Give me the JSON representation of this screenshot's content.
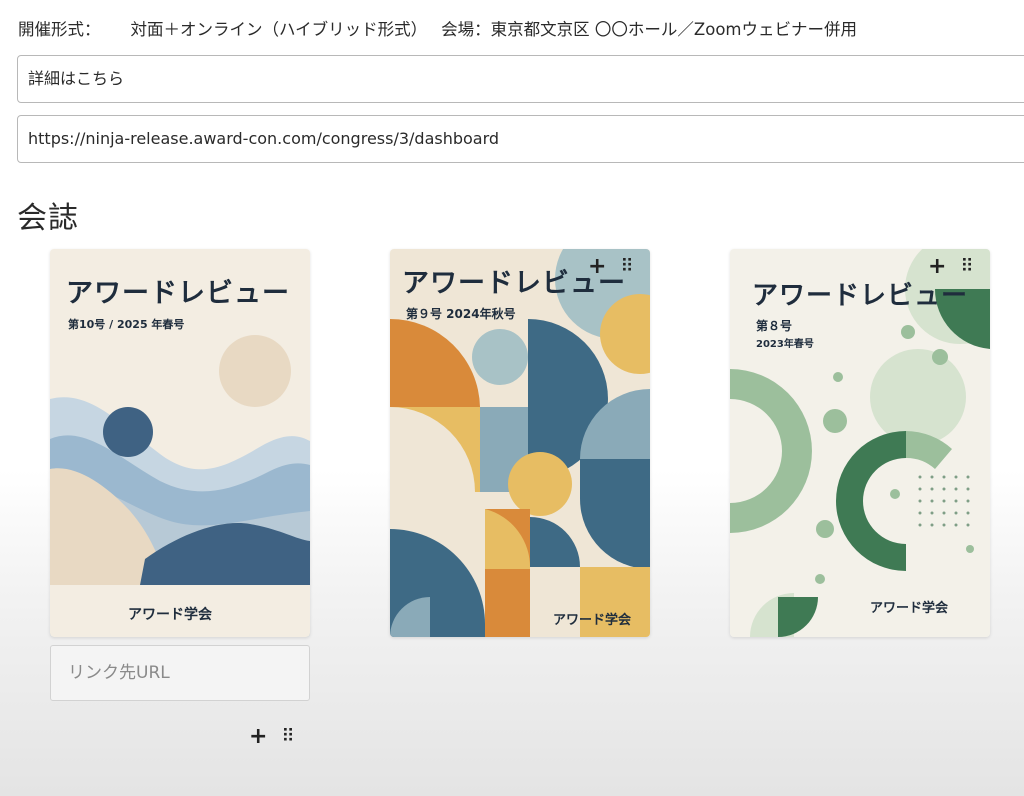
{
  "event": {
    "format_label": "開催形式：",
    "format_value": "対面＋オンライン（ハイブリッド形式）",
    "venue_text": "会場：東京都文京区 〇〇ホール／Zoomウェビナー併用"
  },
  "details_field": {
    "value": "詳細はこちら"
  },
  "url_field": {
    "value": "https://ninja-release.award-con.com/congress/3/dashboard"
  },
  "journal_section": {
    "title": "会誌",
    "covers": [
      {
        "title": "アワードレビュー",
        "issue": "第10号 / 2025 年春号",
        "publisher": "アワード学会",
        "colors": [
          "#f3ede2",
          "#3f6283",
          "#9bb8cf",
          "#e8d9c3"
        ]
      },
      {
        "title": "アワードレビュー",
        "issue": "第９号 2024年秋号",
        "publisher": "アワード学会",
        "colors": [
          "#d98a3a",
          "#e7bd63",
          "#3e6a85",
          "#8aaab8"
        ]
      },
      {
        "title": "アワードレビュー",
        "issue_line1": "第８号",
        "issue_line2": "2023年春号",
        "publisher": "アワード学会",
        "colors": [
          "#f3f1e9",
          "#3f7a54",
          "#9cbf9c",
          "#d6e3cf"
        ]
      }
    ],
    "link_input": {
      "placeholder": "リンク先URL"
    },
    "icons": {
      "add": "+",
      "drag": "⠿"
    }
  }
}
